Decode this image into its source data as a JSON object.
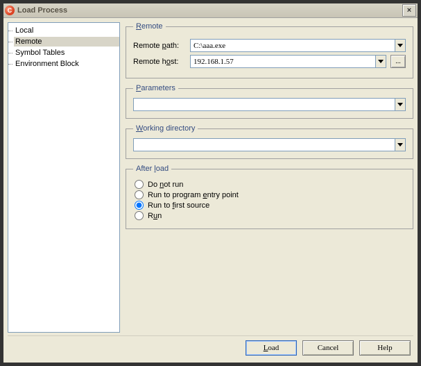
{
  "window": {
    "title": "Load Process",
    "close": "×",
    "icon_letter": "C"
  },
  "tree": {
    "items": [
      {
        "label": "Local",
        "selected": false
      },
      {
        "label": "Remote",
        "selected": true
      },
      {
        "label": "Symbol Tables",
        "selected": false
      },
      {
        "label": "Environment Block",
        "selected": false
      }
    ]
  },
  "remote": {
    "legend": "Remote",
    "path_label": "Remote path:",
    "path_value": "C:\\aaa.exe",
    "host_label": "Remote host:",
    "host_value": "192.168.1.57",
    "browse": "..."
  },
  "parameters": {
    "legend": "Parameters",
    "value": ""
  },
  "working_dir": {
    "legend": "Working directory",
    "value": ""
  },
  "after_load": {
    "legend": "After load",
    "options": [
      {
        "label": "Do not run",
        "checked": false
      },
      {
        "label": "Run to program entry point",
        "checked": false
      },
      {
        "label": "Run to first source",
        "checked": true
      },
      {
        "label": "Run",
        "checked": false
      }
    ]
  },
  "buttons": {
    "load": "Load",
    "cancel": "Cancel",
    "help": "Help"
  }
}
